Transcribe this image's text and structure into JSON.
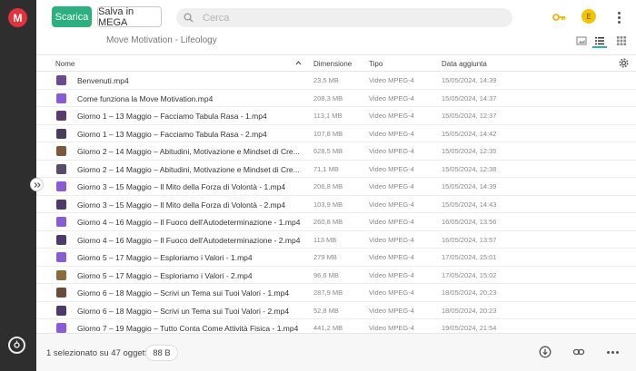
{
  "sidebar": {
    "logo_letter": "M",
    "expand_icon": "double-chevron-right-icon",
    "bottom_icon": "transfer-manager-icon"
  },
  "toolbar": {
    "download_label": "Scarica",
    "save_label": "Salva in MEGA",
    "search_placeholder": "Cerca",
    "avatar_initial": "E",
    "accent_color": "#2bb17f",
    "key_icon_color": "#f0b400"
  },
  "breadcrumb": "Move Motivation - Lifeology",
  "table": {
    "headers": {
      "name": "Nome",
      "size": "Dimensione",
      "type": "Tipo",
      "date": "Data aggiunta"
    },
    "rows": [
      {
        "name": "Benvenuti.mp4",
        "size": "23,5 MB",
        "type": "Video MPEG-4",
        "date": "15/05/2024, 14:39",
        "thumb": "#6b4a8f"
      },
      {
        "name": "Come funziona la Move Motivation.mp4",
        "size": "208,3 MB",
        "type": "Video MPEG-4",
        "date": "15/05/2024, 14:37",
        "thumb": "#8a5bd6"
      },
      {
        "name": "Giorno 1 – 13 Maggio – Facciamo Tabula Rasa - 1.mp4",
        "size": "113,1 MB",
        "type": "Video MPEG-4",
        "date": "15/05/2024, 12:37",
        "thumb": "#5a3a6a"
      },
      {
        "name": "Giorno 1 – 13 Maggio – Facciamo Tabula Rasa - 2.mp4",
        "size": "107,8 MB",
        "type": "Video MPEG-4",
        "date": "15/05/2024, 14:42",
        "thumb": "#4a3a5e"
      },
      {
        "name": "Giorno 2 – 14 Maggio – Abitudini, Motivazione e Mindset di Cre...",
        "size": "628,5 MB",
        "type": "Video MPEG-4",
        "date": "15/05/2024, 12:35",
        "thumb": "#7a5a3a"
      },
      {
        "name": "Giorno 2 – 14 Maggio – Abitudini, Motivazione e Mindset di Cre...",
        "size": "71,1 MB",
        "type": "Video MPEG-4",
        "date": "15/05/2024, 12:38",
        "thumb": "#5a4a6e"
      },
      {
        "name": "Giorno 3 – 15 Maggio – Il Mito della Forza di Volontà - 1.mp4",
        "size": "206,8 MB",
        "type": "Video MPEG-4",
        "date": "15/05/2024, 14:39",
        "thumb": "#8a5bd6"
      },
      {
        "name": "Giorno 3 – 15 Maggio – Il Mito della Forza di Volontà - 2.mp4",
        "size": "103,9 MB",
        "type": "Video MPEG-4",
        "date": "15/05/2024, 14:43",
        "thumb": "#4e3a6a"
      },
      {
        "name": "Giorno 4 – 16 Maggio – Il Fuoco dell'Autodeterminazione - 1.mp4",
        "size": "260,8 MB",
        "type": "Video MPEG-4",
        "date": "16/05/2024, 13:56",
        "thumb": "#8a5bd6"
      },
      {
        "name": "Giorno 4 – 16 Maggio – Il Fuoco dell'Autodeterminazione - 2.mp4",
        "size": "113 MB",
        "type": "Video MPEG-4",
        "date": "16/05/2024, 13:57",
        "thumb": "#4e3a6a"
      },
      {
        "name": "Giorno 5 – 17 Maggio – Esploriamo i Valori - 1.mp4",
        "size": "279 MB",
        "type": "Video MPEG-4",
        "date": "17/05/2024, 15:01",
        "thumb": "#8a5bd6"
      },
      {
        "name": "Giorno 5 – 17 Maggio – Esploriamo i Valori - 2.mp4",
        "size": "96,6 MB",
        "type": "Video MPEG-4",
        "date": "17/05/2024, 15:02",
        "thumb": "#8a6a3a"
      },
      {
        "name": "Giorno 6 – 18 Maggio – Scrivi un Tema sui Tuoi Valori - 1.mp4",
        "size": "287,9 MB",
        "type": "Video MPEG-4",
        "date": "18/05/2024, 20:23",
        "thumb": "#6a4a3a"
      },
      {
        "name": "Giorno 6 – 18 Maggio – Scrivi un Tema sui Tuoi Valori - 2.mp4",
        "size": "52,8 MB",
        "type": "Video MPEG-4",
        "date": "18/05/2024, 20:23",
        "thumb": "#4e3a6a"
      },
      {
        "name": "Giorno 7 – 19 Maggio – Tutto Conta Come Attività Fisica - 1.mp4",
        "size": "441,2 MB",
        "type": "Video MPEG-4",
        "date": "19/05/2024, 21:54",
        "thumb": "#8a5bd6"
      }
    ]
  },
  "footer": {
    "selection_status": "1 selezionato su 47 oggetti",
    "selected_size": "88 B"
  }
}
